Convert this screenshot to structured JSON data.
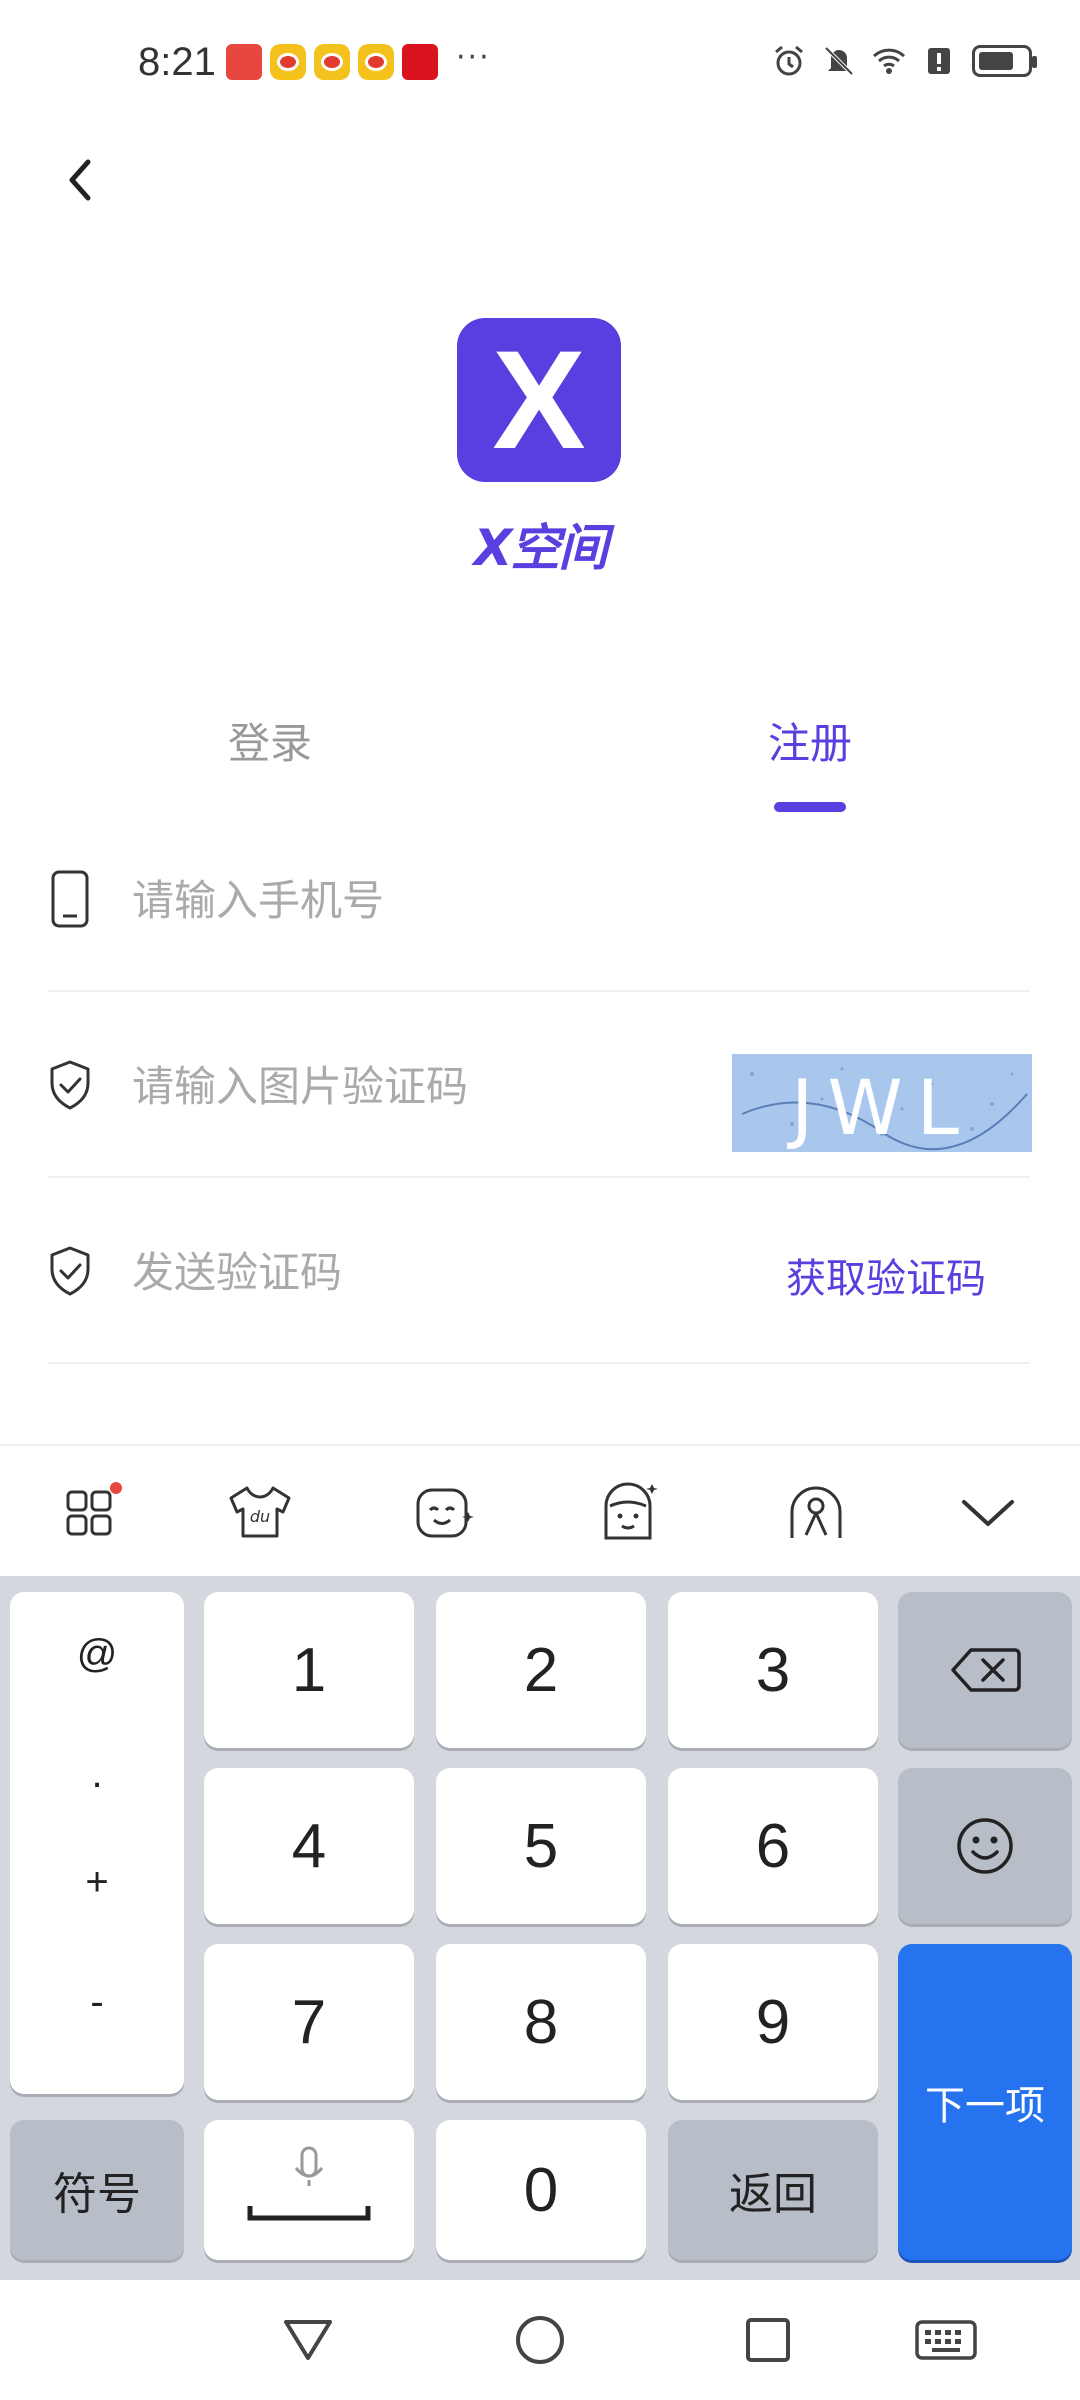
{
  "status_bar": {
    "time": "8:21",
    "more": "···"
  },
  "logo": {
    "letter": "X",
    "name": "X空间",
    "color": "#5a3fe0"
  },
  "tabs": [
    {
      "label": "登录",
      "active": false
    },
    {
      "label": "注册",
      "active": true
    }
  ],
  "form": {
    "phone_placeholder": "请输入手机号",
    "captcha_placeholder": "请输入图片验证码",
    "captcha_text": "JWL",
    "sms_placeholder": "发送验证码",
    "get_code_label": "获取验证码"
  },
  "keyboard": {
    "symbols": [
      "@",
      ".",
      "+",
      "-"
    ],
    "digits": [
      "1",
      "2",
      "3",
      "4",
      "5",
      "6",
      "7",
      "8",
      "9",
      "0"
    ],
    "symbol_key": "符号",
    "return_key": "返回",
    "next_key": "下一项",
    "accent": "#2673f0"
  }
}
